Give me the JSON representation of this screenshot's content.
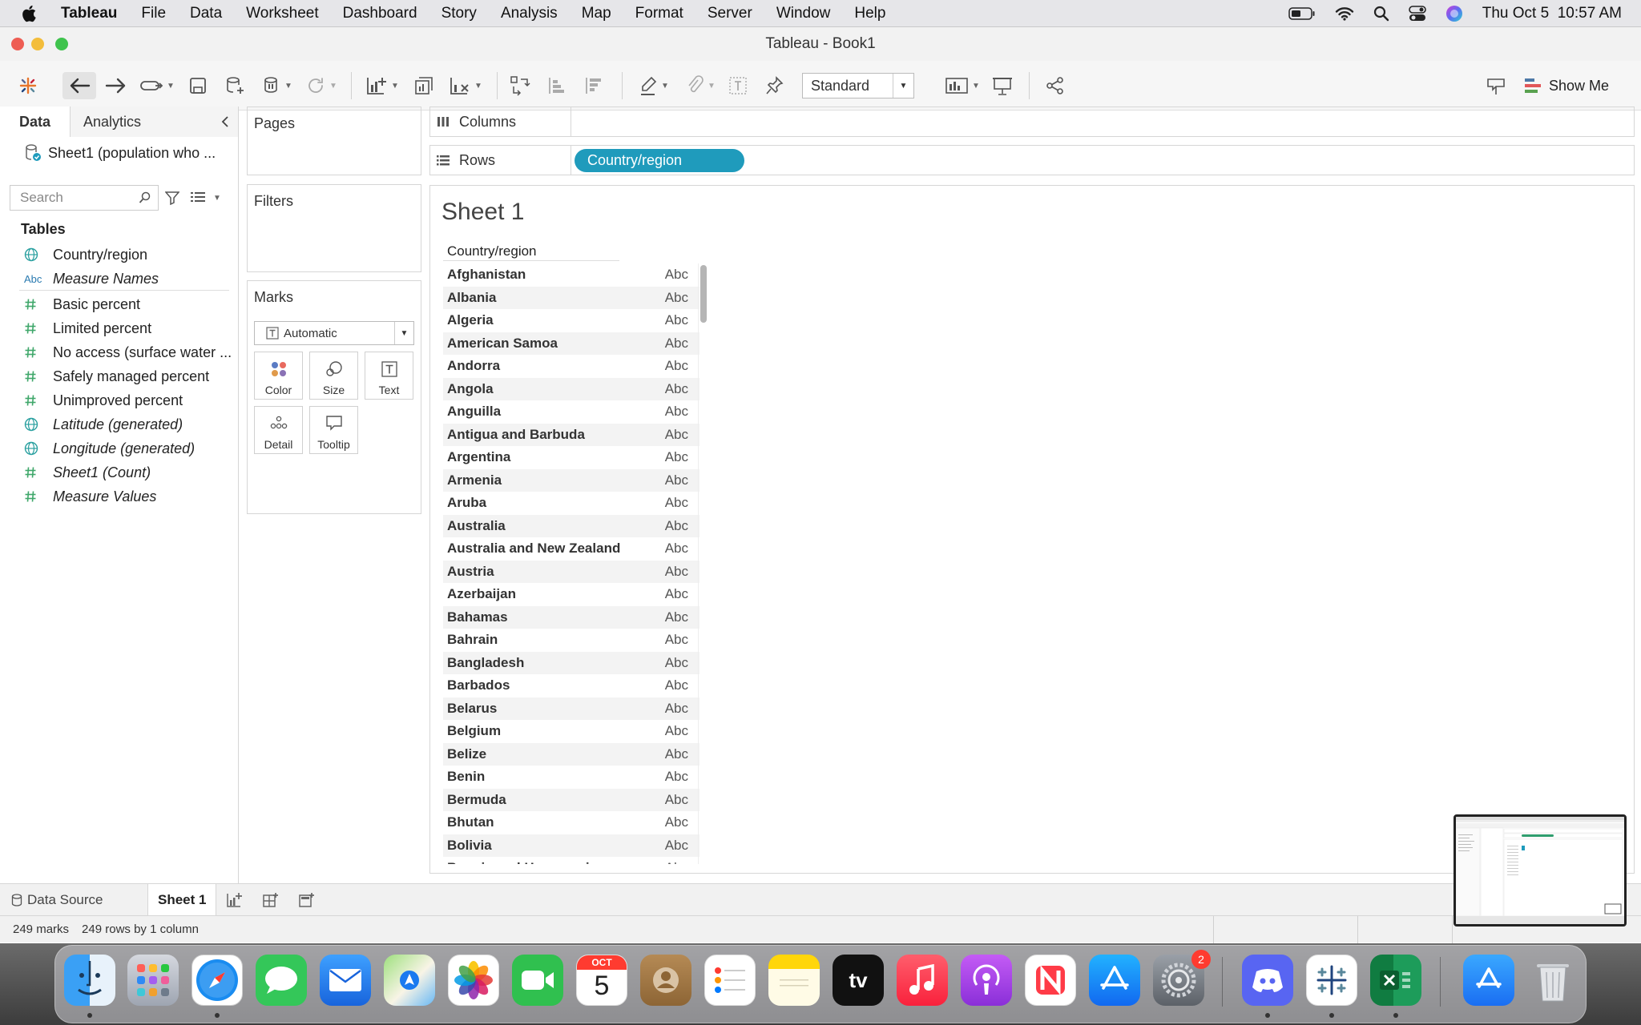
{
  "menubar": {
    "app_name": "Tableau",
    "items": [
      "File",
      "Data",
      "Worksheet",
      "Dashboard",
      "Story",
      "Analysis",
      "Map",
      "Format",
      "Server",
      "Window",
      "Help"
    ],
    "clock": "Thu Oct 5  10:57 AM"
  },
  "window": {
    "title": "Tableau - Book1"
  },
  "toolbar": {
    "fit_value": "Standard",
    "show_me_label": "Show Me"
  },
  "data_pane": {
    "tabs": {
      "data": "Data",
      "analytics": "Analytics"
    },
    "datasource": "Sheet1 (population who ...",
    "search_placeholder": "Search",
    "tables_header": "Tables",
    "fields": [
      {
        "name": "Country/region",
        "type": "geo",
        "italic": false
      },
      {
        "name": "Measure Names",
        "type": "abc",
        "italic": true
      },
      {
        "name": "Basic percent",
        "type": "num",
        "italic": false
      },
      {
        "name": "Limited percent",
        "type": "num",
        "italic": false
      },
      {
        "name": "No access (surface water ...",
        "type": "num",
        "italic": false
      },
      {
        "name": "Safely managed percent",
        "type": "num",
        "italic": false
      },
      {
        "name": "Unimproved percent",
        "type": "num",
        "italic": false
      },
      {
        "name": "Latitude (generated)",
        "type": "geo",
        "italic": true
      },
      {
        "name": "Longitude (generated)",
        "type": "geo",
        "italic": true
      },
      {
        "name": "Sheet1 (Count)",
        "type": "num",
        "italic": true
      },
      {
        "name": "Measure Values",
        "type": "num",
        "italic": true
      }
    ],
    "abc_glyph": "Abc"
  },
  "shelves": {
    "pages": "Pages",
    "filters": "Filters",
    "marks": "Marks",
    "mark_type": "Automatic",
    "mark_buttons": {
      "color": "Color",
      "size": "Size",
      "text": "Text",
      "detail": "Detail",
      "tooltip": "Tooltip"
    },
    "columns": "Columns",
    "rows": "Rows",
    "rows_pill": "Country/region"
  },
  "view": {
    "sheet_title": "Sheet 1",
    "column_header": "Country/region",
    "mark_text": "Abc",
    "rows": [
      "Afghanistan",
      "Albania",
      "Algeria",
      "American Samoa",
      "Andorra",
      "Angola",
      "Anguilla",
      "Antigua and Barbuda",
      "Argentina",
      "Armenia",
      "Aruba",
      "Australia",
      "Australia and New Zealand",
      "Austria",
      "Azerbaijan",
      "Bahamas",
      "Bahrain",
      "Bangladesh",
      "Barbados",
      "Belarus",
      "Belgium",
      "Belize",
      "Benin",
      "Bermuda",
      "Bhutan",
      "Bolivia",
      "Bosnia and Herzegovina"
    ]
  },
  "bottom_tabs": {
    "data_source": "Data Source",
    "sheet": "Sheet 1"
  },
  "status": {
    "marks": "249 marks",
    "rows_cols": "249 rows by 1 column"
  },
  "dock": {
    "calendar_month": "OCT",
    "calendar_day": "5",
    "tv_label": "tv",
    "discord_badge": "2",
    "colors": {
      "accent_pill": "#1f9bbc",
      "field_green": "#3fa76a",
      "geo_teal": "#2aa0a0"
    }
  }
}
